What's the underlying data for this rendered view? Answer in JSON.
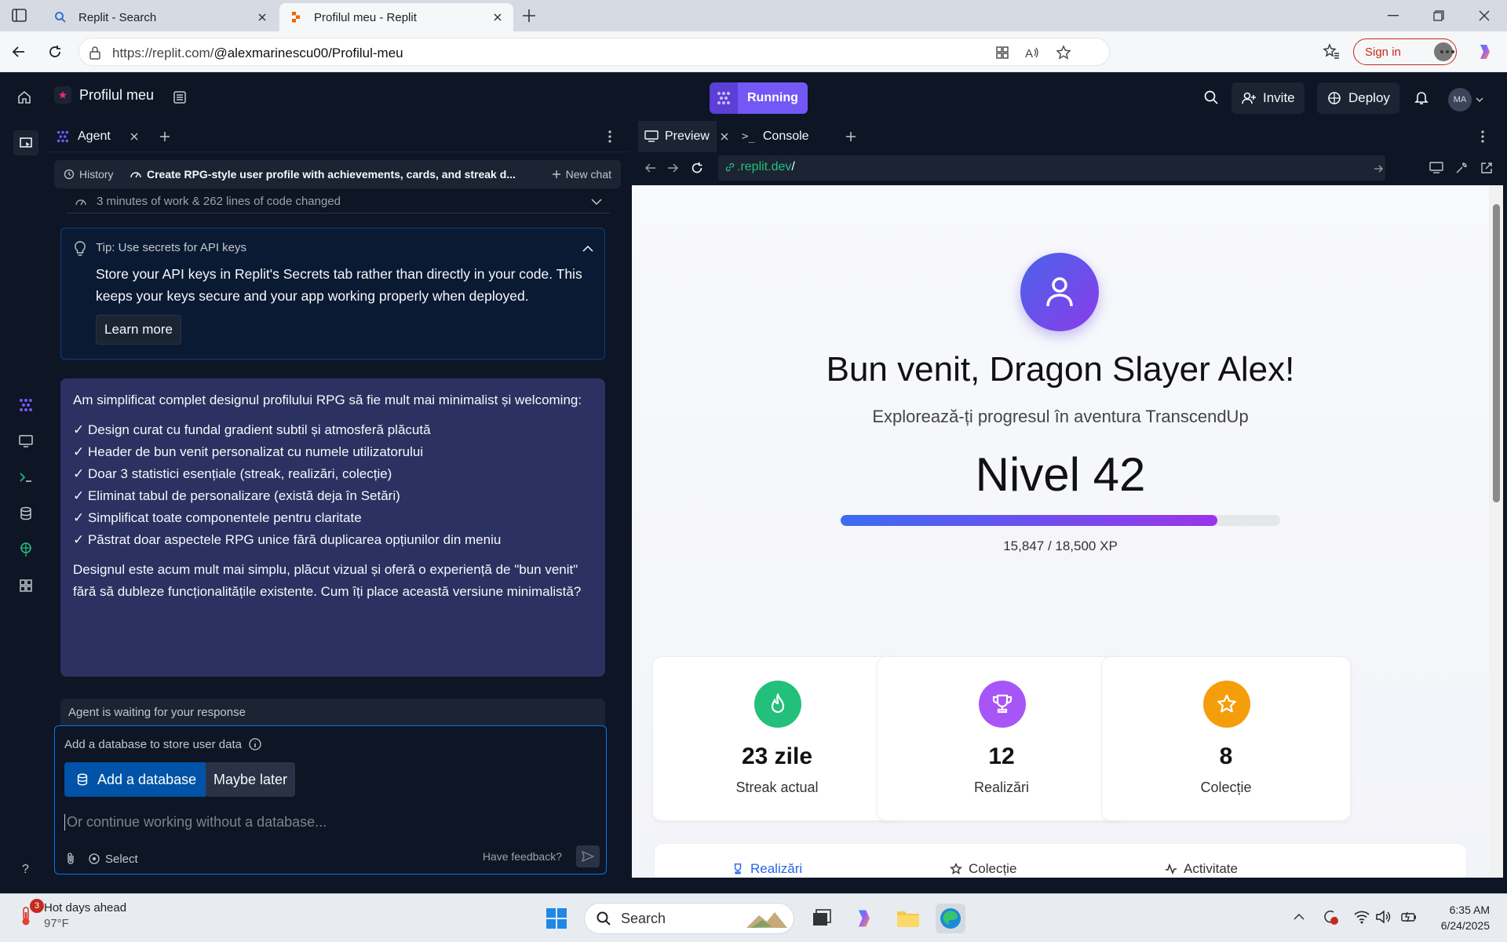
{
  "browser": {
    "tabs": [
      {
        "label": "Replit - Search",
        "icon": "search-icon"
      },
      {
        "label": "Profilul meu - Replit",
        "icon": "replit-icon"
      }
    ],
    "url_prefix": "https://replit.com/",
    "url_path": "@alexmarinescu00/Profilul-meu",
    "sign_in": "Sign in"
  },
  "replit": {
    "project_name": "Profilul meu",
    "status": "Running",
    "invite": "Invite",
    "deploy": "Deploy",
    "avatar_initials": "MA"
  },
  "agent": {
    "tab_label": "Agent",
    "history": "History",
    "chat_title": "Create RPG-style user profile with achievements, cards, and streak d...",
    "new_chat": "New chat",
    "work_summary": "3 minutes of work & 262 lines of code changed",
    "tip_title": "Tip: Use secrets for API keys",
    "tip_body": "Store your API keys in Replit's Secrets tab rather than directly in your code. This keeps your keys secure and your app working properly when deployed.",
    "learn_more": "Learn more",
    "message_intro": "Am simplificat complet designul profilului RPG să fie mult mai minimalist și welcoming:",
    "message_items": [
      "✓ Design curat cu fundal gradient subtil și atmosferă plăcută",
      "✓ Header de bun venit personalizat cu numele utilizatorului",
      "✓ Doar 3 statistici esențiale (streak, realizări, colecție)",
      "✓ Eliminat tabul de personalizare (există deja în Setări)",
      "✓ Simplificat toate componentele pentru claritate",
      "✓ Păstrat doar aspectele RPG unice fără duplicarea opțiunilor din meniu"
    ],
    "message_outro": "Designul este acum mult mai simplu, plăcut vizual și oferă o experiență de \"bun venit\" fără să dubleze funcționalitățile existente. Cum îți place această versiune minimalistă?",
    "waiting": "Agent is waiting for your response",
    "db_prompt": "Add a database to store user data",
    "add_db": "Add a database",
    "maybe_later": "Maybe later",
    "input_placeholder": "Or continue working without a database...",
    "select": "Select",
    "feedback": "Have feedback?"
  },
  "preview": {
    "tab_preview": "Preview",
    "tab_console": "Console",
    "url_host": ".replit.dev",
    "url_path": "/",
    "welcome": "Bun venit, Dragon Slayer Alex!",
    "subtitle": "Explorează-ți progresul în aventura TranscendUp",
    "level": "Nivel 42",
    "xp_text": "15,847 / 18,500 XP",
    "xp_fraction": 0.8566,
    "stats": [
      {
        "value": "23 zile",
        "label": "Streak actual",
        "icon": "flame-icon",
        "color": "#22c07a"
      },
      {
        "value": "12",
        "label": "Realizări",
        "icon": "trophy-icon",
        "color": "#a855f7"
      },
      {
        "value": "8",
        "label": "Colecție",
        "icon": "star-icon",
        "color": "#f59e0b"
      }
    ],
    "bottom_tabs": [
      "Realizări",
      "Colecție",
      "Activitate"
    ]
  },
  "taskbar": {
    "weather_title": "Hot days ahead",
    "weather_temp": "97°F",
    "weather_badge": "3",
    "search": "Search",
    "time": "6:35 AM",
    "date": "6/24/2025"
  }
}
